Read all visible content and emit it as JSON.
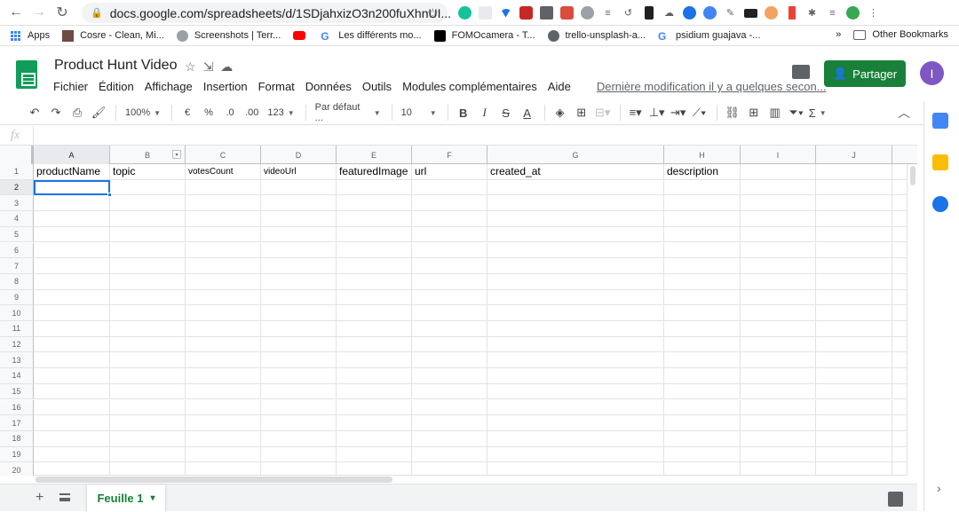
{
  "browser": {
    "url": "docs.google.com/spreadsheets/d/1SDjahxizO3n200fuXhnUI...",
    "bookmarks": [
      {
        "label": "Apps"
      },
      {
        "label": "Cosre - Clean, Mi..."
      },
      {
        "label": "Screenshots | Terr..."
      },
      {
        "label": ""
      },
      {
        "label": "Les différents mo..."
      },
      {
        "label": "FOMOcamera - T..."
      },
      {
        "label": "trello-unsplash-a..."
      },
      {
        "label": "psidium guajava -..."
      }
    ],
    "more_bookmarks": "»",
    "other_bookmarks": "Other Bookmarks"
  },
  "doc": {
    "title": "Product Hunt Video",
    "share_label": "Partager",
    "avatar_initial": "I",
    "menus": [
      "Fichier",
      "Édition",
      "Affichage",
      "Insertion",
      "Format",
      "Données",
      "Outils",
      "Modules complémentaires",
      "Aide"
    ],
    "last_edit": "Dernière modification il y a quelques secon..."
  },
  "toolbar": {
    "zoom": "100%",
    "currency": "€",
    "percent": "%",
    "dec_less": ".0",
    "dec_more": ".00",
    "more_formats": "123",
    "font": "Par défaut ...",
    "font_size": "10",
    "sum": "Σ"
  },
  "formula": {
    "fx": "fx",
    "value": ""
  },
  "columns": [
    "A",
    "B",
    "C",
    "D",
    "E",
    "F",
    "G",
    "H",
    "I",
    "J"
  ],
  "rows": [
    "1",
    "2",
    "3",
    "4",
    "5",
    "6",
    "7",
    "8",
    "9",
    "10",
    "11",
    "12",
    "13",
    "14",
    "15",
    "16",
    "17",
    "18",
    "19",
    "20"
  ],
  "row1": [
    "productName",
    "topic",
    "votesCount",
    "videoUrl",
    "featuredImage",
    "url",
    "created_at",
    "",
    "description",
    "",
    ""
  ],
  "sheet": {
    "tab": "Feuille 1",
    "tab_arrow": "▾",
    "add": "+"
  },
  "colors": {
    "share_green": "#188038",
    "selection_blue": "#1a73e8",
    "avatar_purple": "#7e57c2"
  }
}
